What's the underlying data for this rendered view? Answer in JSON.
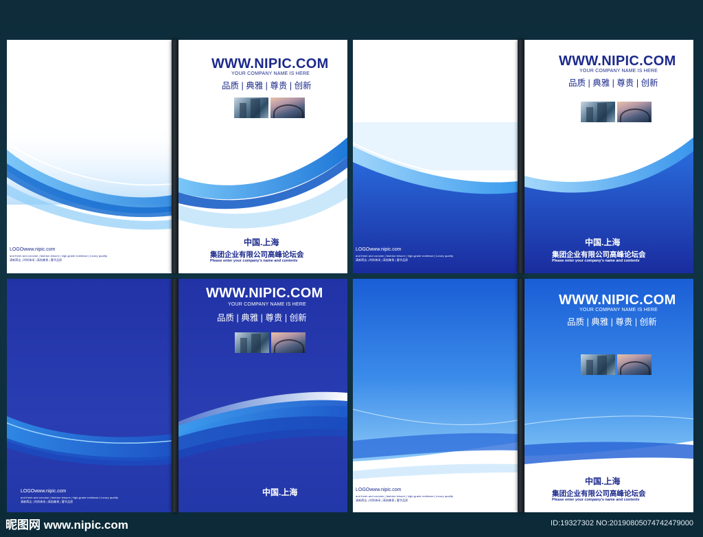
{
  "brand": {
    "site": "WWW.NIPIC.COM",
    "company_en": "YOUR COMPANY NAME IS HERE",
    "slogan": "品质 | 典雅 | 尊贵 | 创新",
    "city": "中国.上海",
    "forum": "集团企业有限公司高峰论坛会",
    "prompt": "Please enter your company's name and contentv",
    "logo_line": "LOGOwww.nipic.com",
    "tiny_line_1": "and fresh and concise | fashion leisure | high-grade noblesse | luxury quality",
    "tiny_line_2": "清新简洁 | 时尚休闲 | 高档尊贵 | 奢华品质"
  },
  "watermark": {
    "left": "昵图网 www.nipic.com",
    "right": "ID:19327302 NO:20190805074742479000"
  },
  "colors": {
    "dark_blue": "#1c2a8c",
    "royal_blue": "#2233a8",
    "light_blue": "#4aa8f0"
  }
}
